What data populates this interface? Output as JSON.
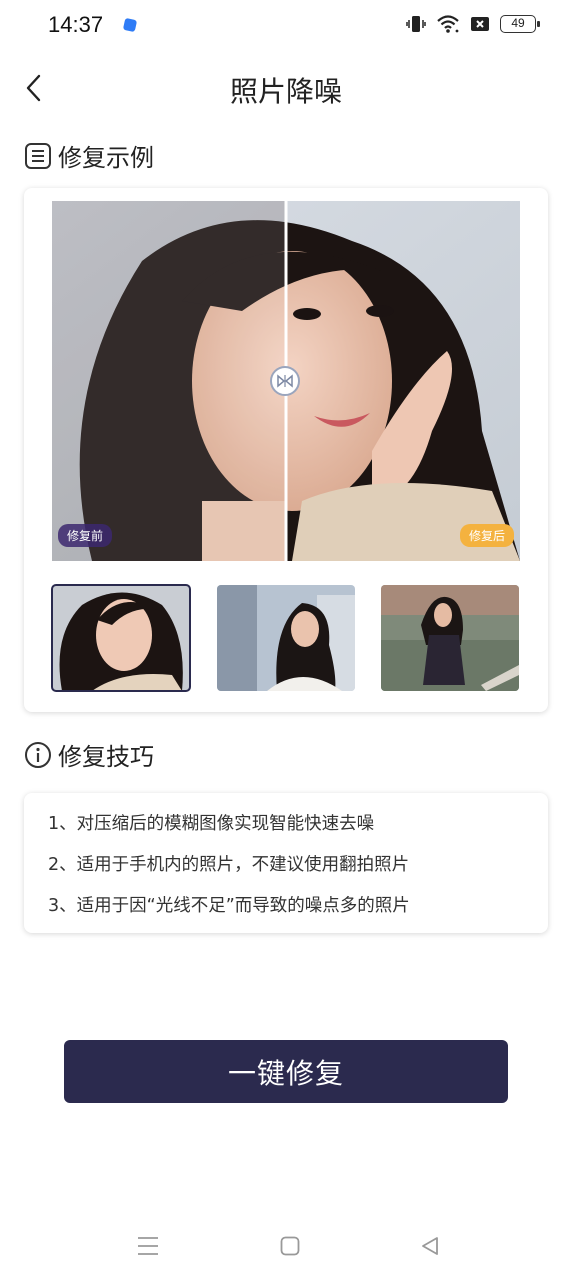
{
  "status_bar": {
    "time": "14:37",
    "battery": "49",
    "icons": [
      "vibrate-icon",
      "wifi-icon",
      "sim-off-icon",
      "battery-icon"
    ]
  },
  "header": {
    "title": "照片降噪",
    "back_icon": "chevron-left-icon"
  },
  "example_section": {
    "title": "修复示例",
    "icon": "list-icon",
    "before_label": "修复前",
    "after_label": "修复后",
    "thumbnails": [
      {
        "subject": "portrait-closeup",
        "selected": true
      },
      {
        "subject": "portrait-window",
        "selected": false
      },
      {
        "subject": "full-body-outdoor",
        "selected": false
      }
    ]
  },
  "tips_section": {
    "title": "修复技巧",
    "icon": "info-icon",
    "tips": [
      "1、对压缩后的模糊图像实现智能快速去噪",
      "2、适用于手机内的照片，不建议使用翻拍照片",
      "3、适用于因“光线不足”而导致的噪点多的照片"
    ]
  },
  "action": {
    "label": "一键修复"
  },
  "colors": {
    "primary": "#2b2a4e",
    "after_tag": "#f4b23f",
    "before_tag": "#3c286e"
  }
}
